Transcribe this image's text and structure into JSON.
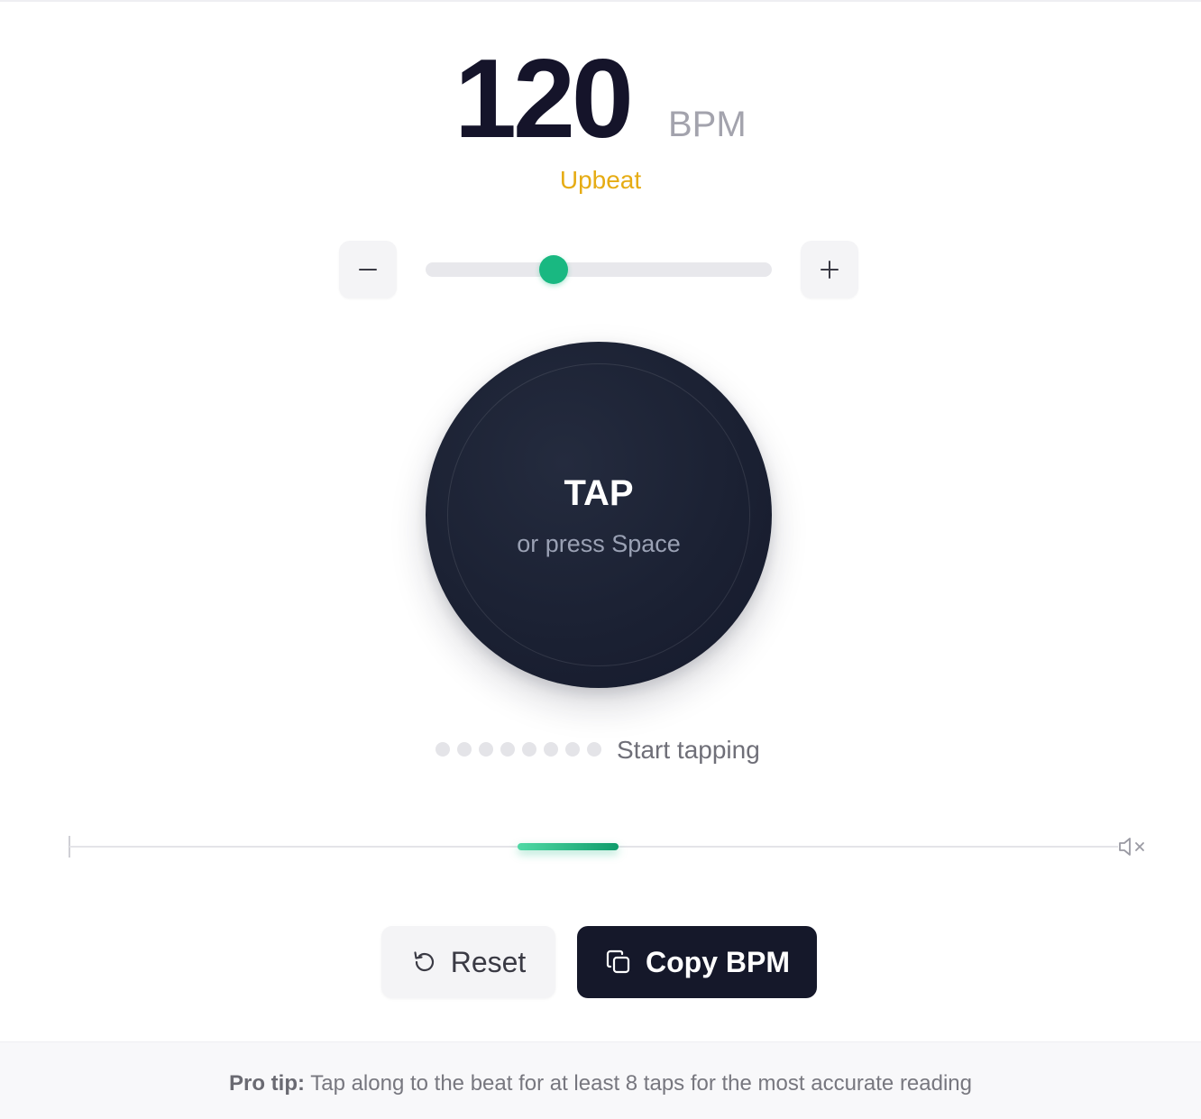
{
  "tempo": {
    "bpm": "120",
    "unit": "BPM",
    "label": "Upbeat",
    "label_color": "#e6ac14",
    "slider_fraction": 0.37,
    "accent_color": "#19b881"
  },
  "controls": {
    "decrease_icon": "minus-icon",
    "increase_icon": "plus-icon"
  },
  "tap": {
    "title": "TAP",
    "hint": "or press Space"
  },
  "taps": {
    "dot_count": 8,
    "filled": 0,
    "status": "Start tapping"
  },
  "beat": {
    "mute_icon": "speaker-muted-icon"
  },
  "actions": {
    "reset_label": "Reset",
    "reset_icon": "reset-icon",
    "copy_label": "Copy BPM",
    "copy_icon": "copy-icon"
  },
  "footer": {
    "tip_label": "Pro tip:",
    "tip_text": " Tap along to the beat for at least 8 taps for the most accurate reading"
  }
}
